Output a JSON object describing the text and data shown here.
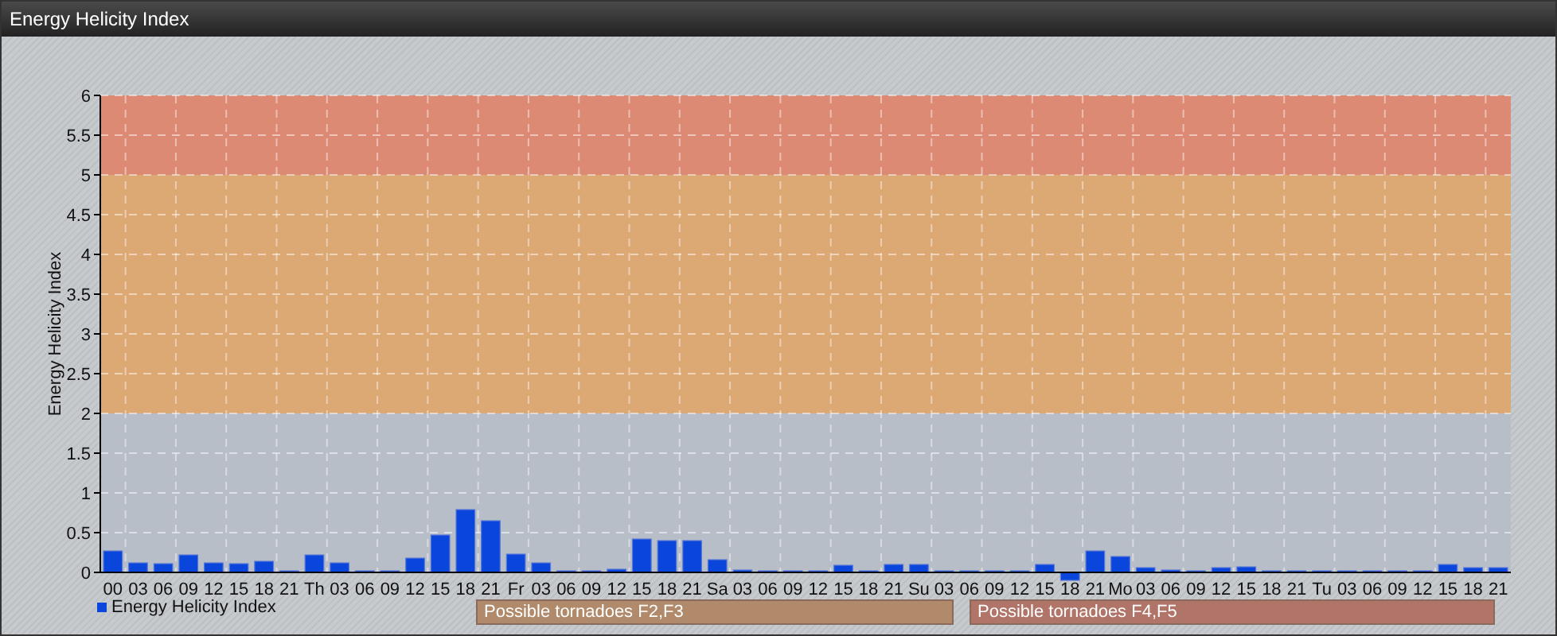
{
  "window": {
    "title": "Energy Helicity Index"
  },
  "chart": {
    "chart_data": {
      "type": "bar",
      "ylabel": "Energy Helicity Index",
      "categories": [
        "00",
        "03",
        "06",
        "09",
        "12",
        "15",
        "18",
        "21",
        "Th",
        "03",
        "06",
        "09",
        "12",
        "15",
        "18",
        "21",
        "Fr",
        "03",
        "06",
        "09",
        "12",
        "15",
        "18",
        "21",
        "Sa",
        "03",
        "06",
        "09",
        "12",
        "15",
        "18",
        "21",
        "Su",
        "03",
        "06",
        "09",
        "12",
        "15",
        "18",
        "21",
        "Mo",
        "03",
        "06",
        "09",
        "12",
        "15",
        "18",
        "21",
        "Tu",
        "03",
        "06",
        "09",
        "12",
        "15",
        "18",
        "21"
      ],
      "series": [
        {
          "name": "Energy Helicity Index",
          "color": "#0a46dc",
          "values": [
            0.27,
            0.12,
            0.11,
            0.22,
            0.12,
            0.11,
            0.14,
            0.02,
            0.22,
            0.12,
            0.02,
            0.02,
            0.18,
            0.47,
            0.79,
            0.65,
            0.23,
            0.12,
            0.02,
            0.02,
            0.04,
            0.42,
            0.4,
            0.4,
            0.16,
            0.03,
            0.02,
            0.02,
            0.02,
            0.09,
            0.02,
            0.1,
            0.1,
            0.02,
            0.02,
            0.02,
            0.02,
            0.1,
            -0.1,
            0.27,
            0.2,
            0.06,
            0.03,
            0.02,
            0.06,
            0.07,
            0.02,
            0.02,
            0.02,
            0.02,
            0.02,
            0.02,
            0.02,
            0.1,
            0.06,
            0.06
          ]
        }
      ],
      "ylim": [
        -0.12,
        6
      ],
      "grid": true,
      "yticks": [
        0,
        0.5,
        1,
        1.5,
        2,
        2.5,
        3,
        3.5,
        4,
        4.5,
        5,
        5.5,
        6
      ],
      "bands": [
        {
          "axis": "y",
          "from": 0,
          "to": 2,
          "color": "#b8bec8"
        },
        {
          "axis": "y",
          "from": 2,
          "to": 5,
          "color": "#dca874"
        },
        {
          "axis": "y",
          "from": 5,
          "to": 6,
          "color": "#dc8a74"
        }
      ]
    }
  },
  "zones": [
    {
      "label": "Possible tornadoes F2,F3",
      "color": "#b08a6a"
    },
    {
      "label": "Possible tornadoes F4,F5",
      "color": "#b07468"
    }
  ]
}
